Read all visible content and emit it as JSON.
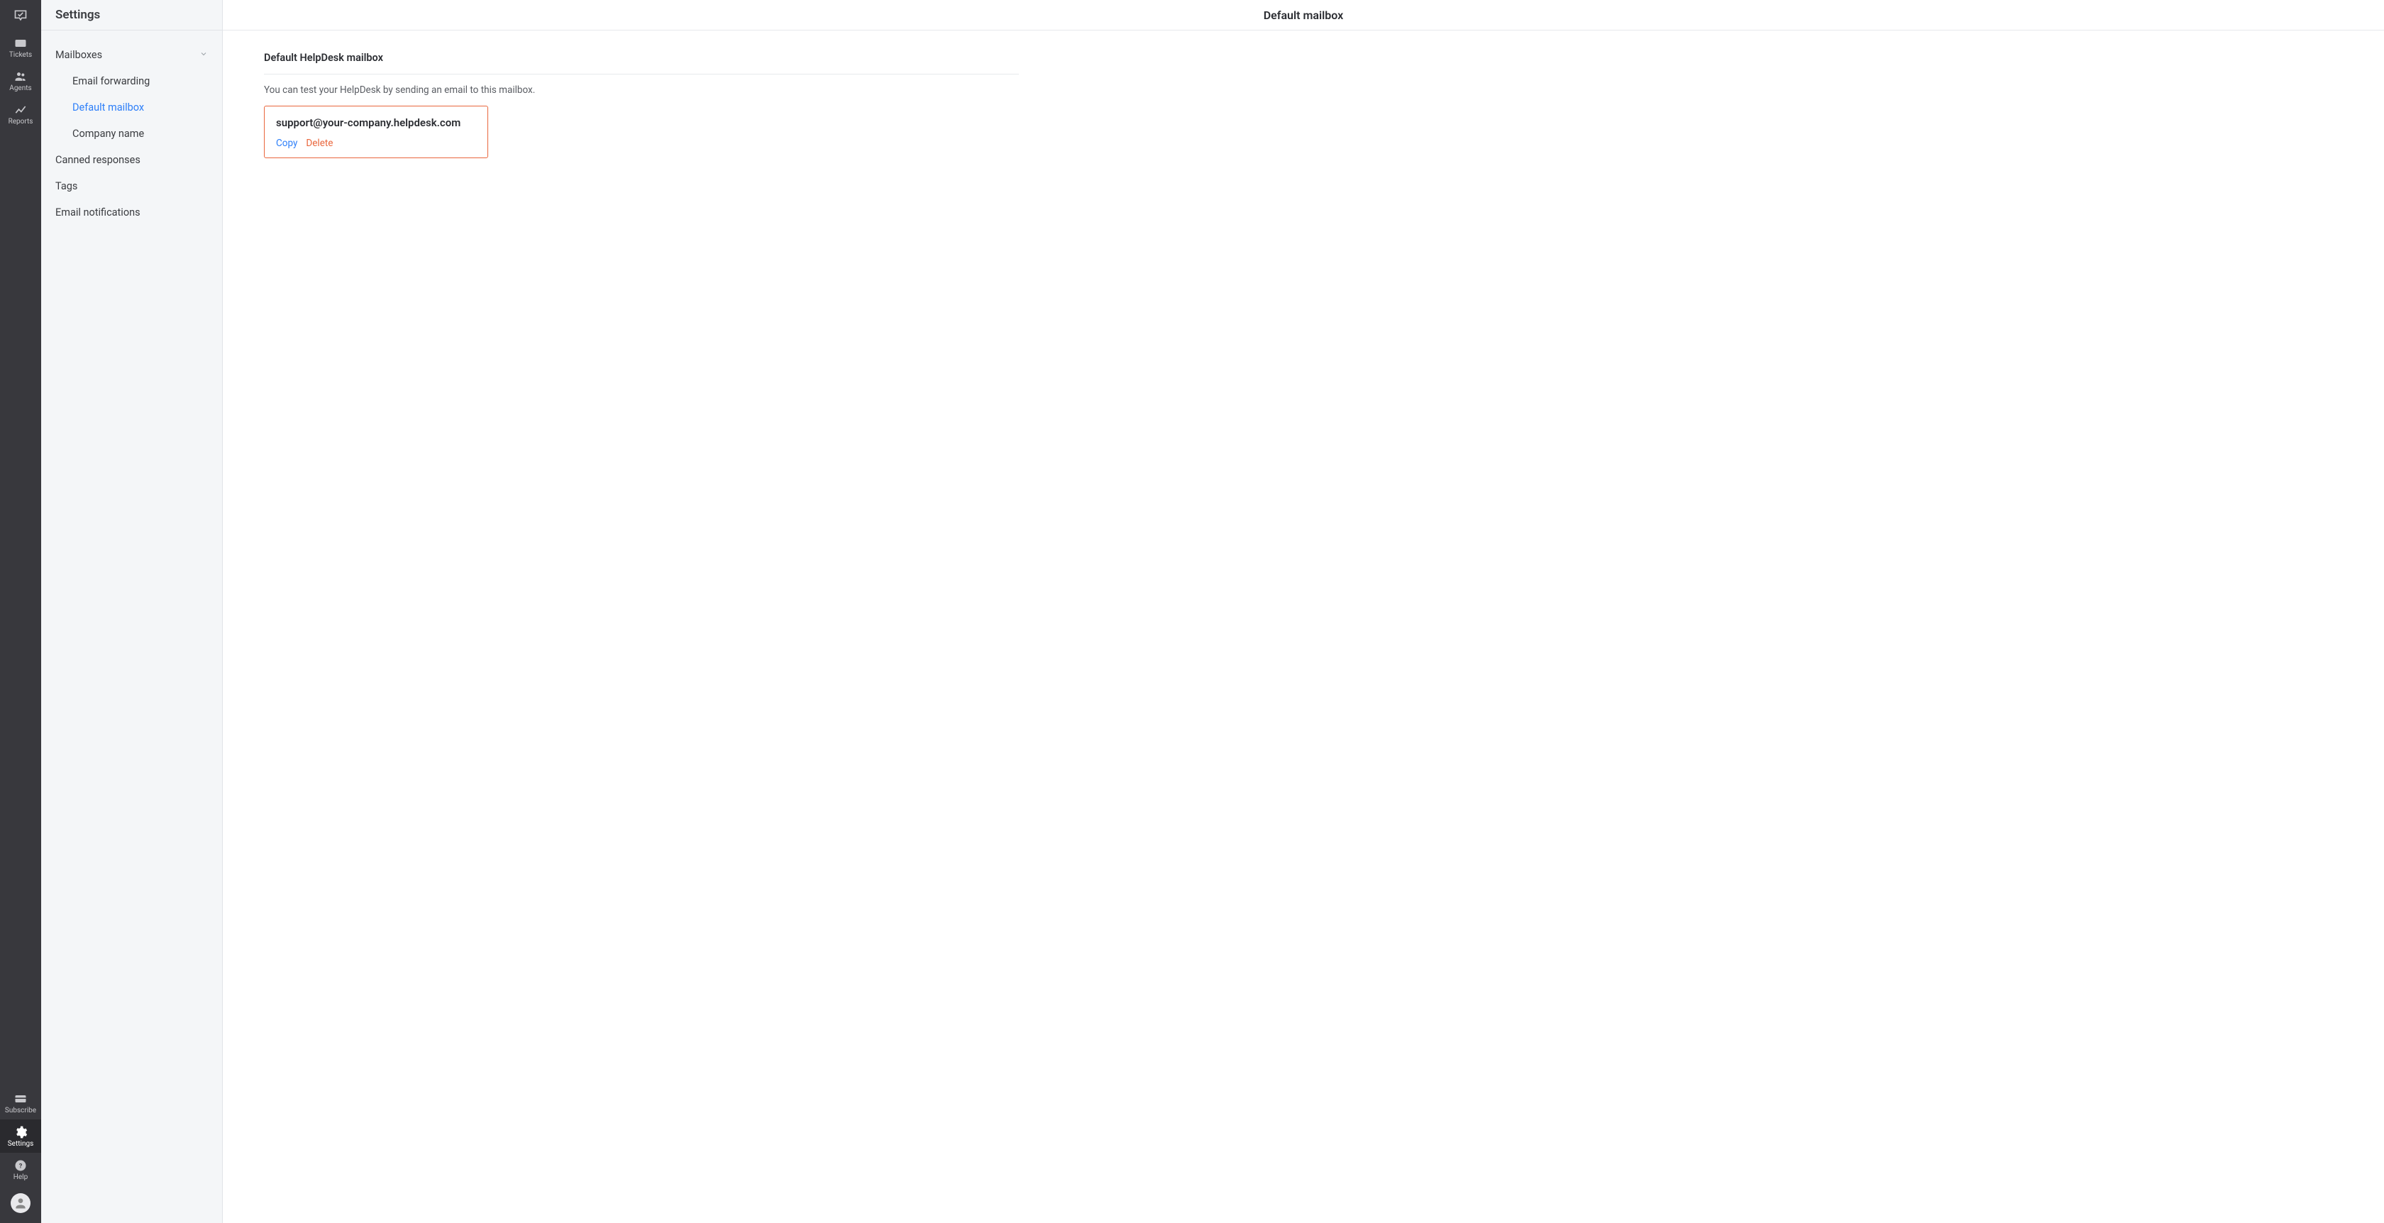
{
  "nav": {
    "tickets": "Tickets",
    "agents": "Agents",
    "reports": "Reports",
    "subscribe": "Subscribe",
    "settings": "Settings",
    "help": "Help"
  },
  "sidebar": {
    "title": "Settings",
    "mailboxes": {
      "label": "Mailboxes",
      "items": {
        "forwarding": "Email forwarding",
        "default": "Default mailbox",
        "company": "Company name"
      }
    },
    "canned": "Canned responses",
    "tags": "Tags",
    "emailNotifications": "Email notifications"
  },
  "main": {
    "header": "Default mailbox",
    "sectionTitle": "Default HelpDesk mailbox",
    "description": "You can test your HelpDesk by sending an email to this mailbox.",
    "mailbox": {
      "email": "support@your-company.helpdesk.com",
      "copy": "Copy",
      "delete": "Delete"
    }
  }
}
